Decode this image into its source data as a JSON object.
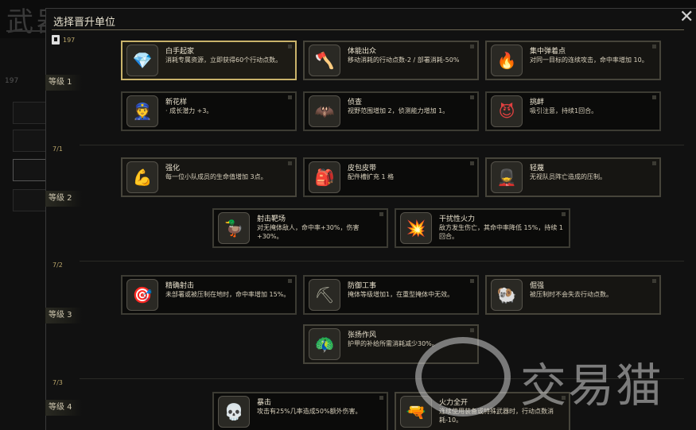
{
  "background": {
    "title": "武器库 - 小队",
    "points": "197"
  },
  "dialog": {
    "title": "选择晋升单位",
    "close_label": "✕",
    "points": "197"
  },
  "tiers": [
    {
      "label": "等级 1",
      "count": ""
    },
    {
      "label": "等级 2",
      "count": "7/1"
    },
    {
      "label": "等级 3",
      "count": "7/2"
    },
    {
      "label": "等级 4",
      "count": "7/3"
    }
  ],
  "cards": [
    {
      "name": "白手起家",
      "desc": "消耗专属资源，立即获得60个行动点数。",
      "icon": "diamond-icon",
      "glyph": "💎",
      "color": "#6ac8f0"
    },
    {
      "name": "体能出众",
      "desc": "移动消耗的行动点数-2 / 部署消耗-50%",
      "icon": "axe-icon",
      "glyph": "🪓",
      "color": "#e0b030"
    },
    {
      "name": "集中弹着点",
      "desc": "对同一目标的连续攻击，命中率增加 10。",
      "icon": "fire-icon",
      "glyph": "🔥",
      "color": "#d06040"
    },
    {
      "name": "新花样",
      "desc": "· 成长潜力 +3。",
      "icon": "officer-icon",
      "glyph": "👮",
      "color": "#6080a0"
    },
    {
      "name": "侦查",
      "desc": "视野范围增加 2，侦测能力增加 1。",
      "icon": "bat-icon",
      "glyph": "🦇",
      "color": "#60a070"
    },
    {
      "name": "挑衅",
      "desc": "吸引注意，持续1回合。",
      "icon": "devil-icon",
      "glyph": "😈",
      "color": "#e04040"
    },
    {
      "name": "强化",
      "desc": "每一位小队成员的生命值增加 3点。",
      "icon": "muscle-icon",
      "glyph": "💪",
      "color": "#c04040"
    },
    {
      "name": "皮包皮带",
      "desc": "配件槽扩充 1 格",
      "icon": "backpack-icon",
      "glyph": "🎒",
      "color": "#8a6a40"
    },
    {
      "name": "轻蔑",
      "desc": "无视队员阵亡造成的压制。",
      "icon": "soldier-icon",
      "glyph": "💂",
      "color": "#c0b090"
    },
    {
      "name": "射击靶场",
      "desc": "对无掩体敌人，命中率+30%，伤害+30%。",
      "icon": "duck-icon",
      "glyph": "🦆",
      "color": "#e0c030"
    },
    {
      "name": "干扰性火力",
      "desc": "敌方发生伤亡，其命中率降低 15%，持续 1 回合。",
      "icon": "explosion-icon",
      "glyph": "💥",
      "color": "#d0a020"
    },
    {
      "name": "精确射击",
      "desc": "未部署或被压制在地时，命中率增加 15%。",
      "icon": "sniper-icon",
      "glyph": "🎯",
      "color": "#a09060"
    },
    {
      "name": "防御工事",
      "desc": "掩体等级增加1，在重型掩体中无效。",
      "icon": "shovel-icon",
      "glyph": "⛏",
      "color": "#a0a090"
    },
    {
      "name": "倔强",
      "desc": "被压制时不会失去行动点数。",
      "icon": "ram-icon",
      "glyph": "🐏",
      "color": "#d0c8b0"
    },
    {
      "name": "张扬作风",
      "desc": "护甲的补给所需消耗减少30%。",
      "icon": "peacock-icon",
      "glyph": "🦚",
      "color": "#40a0a0"
    },
    {
      "name": "暴击",
      "desc": "攻击有25%几率造成50%额外伤害。",
      "icon": "skull-icon",
      "glyph": "💀",
      "color": "#b0a080"
    },
    {
      "name": "火力全开",
      "desc": "连续使用装备或特殊武器时，行动点数消耗-10。",
      "icon": "gunner-icon",
      "glyph": "🔫",
      "color": "#908070"
    }
  ],
  "watermark": {
    "text": "交易猫"
  }
}
